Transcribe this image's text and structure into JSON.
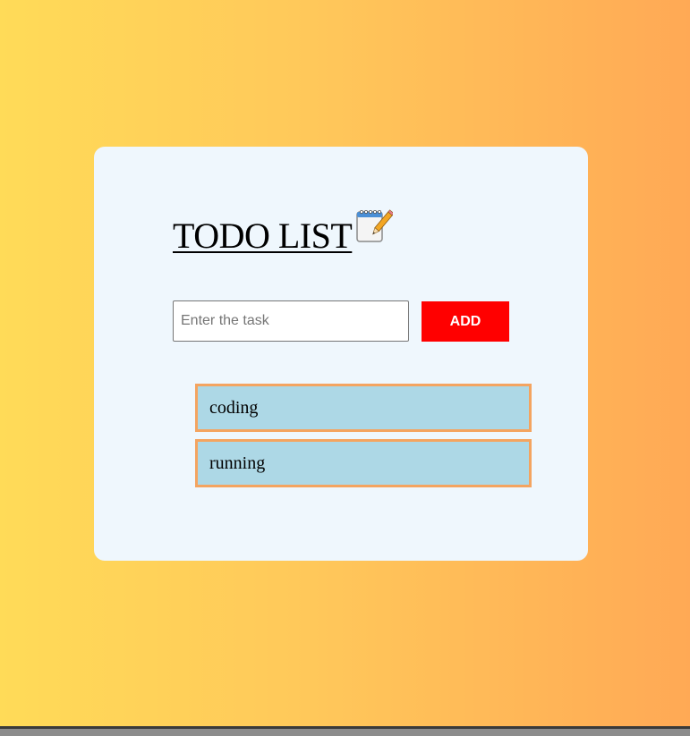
{
  "app": {
    "title": "TODO LIST",
    "title_icon": "notepad-pencil-icon"
  },
  "form": {
    "input_value": "",
    "input_placeholder": "Enter the task",
    "add_label": "ADD"
  },
  "tasks": [
    {
      "text": "coding"
    },
    {
      "text": "running"
    }
  ],
  "colors": {
    "background_gradient_start": "#ffdb58",
    "background_gradient_end": "#ffa955",
    "card_background": "#eff7fd",
    "add_button": "#ff0000",
    "task_background": "#add8e6",
    "task_border": "#f4a460"
  }
}
